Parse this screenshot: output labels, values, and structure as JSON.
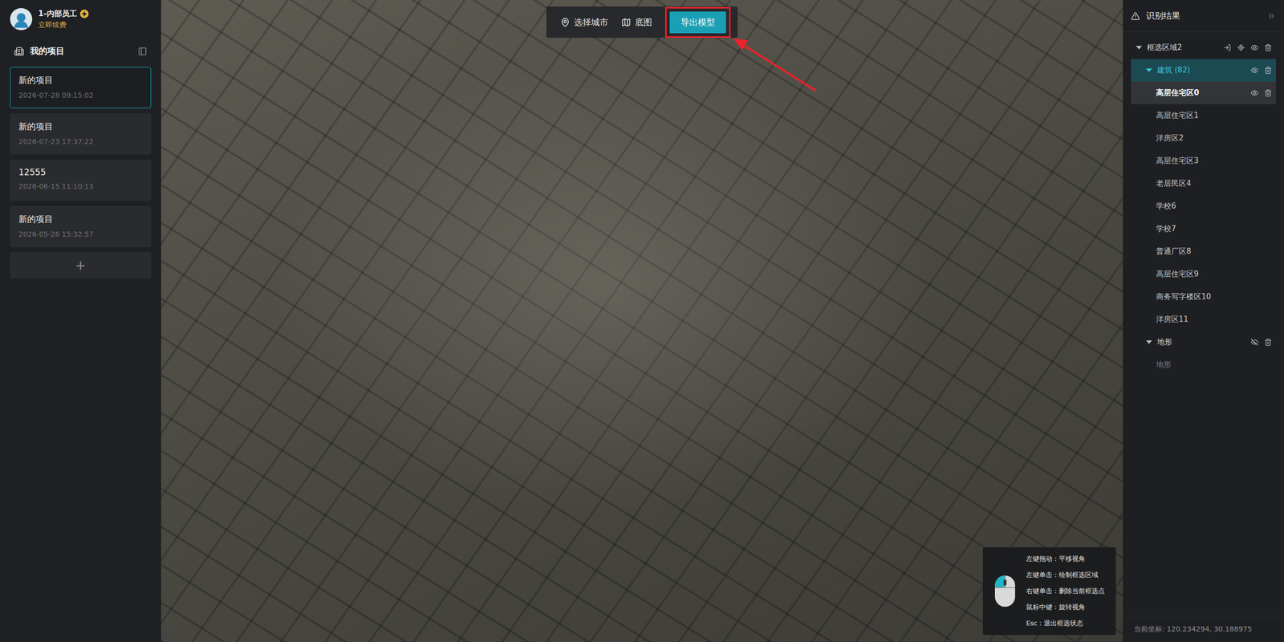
{
  "user": {
    "name": "1-内部员工",
    "renew": "立即续费"
  },
  "projects_header": "我的项目",
  "projects": [
    {
      "name": "新的项目",
      "time": "2026-07-28 09:15:02",
      "selected": true
    },
    {
      "name": "新的项目",
      "time": "2026-07-23 17:37:22",
      "selected": false
    },
    {
      "name": "12555",
      "time": "2026-06-15 11:10:13",
      "selected": false
    },
    {
      "name": "新的项目",
      "time": "2026-05-26 15:32:57",
      "selected": false
    }
  ],
  "add_project": "+",
  "toolbar": [
    {
      "label": "选择城市",
      "kind": "city",
      "annotated": false
    },
    {
      "label": "底图",
      "kind": "basemap",
      "annotated": false
    },
    {
      "label": "导出模型",
      "kind": "primary",
      "annotated": true
    }
  ],
  "panel": {
    "title": "识别结果",
    "region": {
      "label": "框选区域2",
      "expanded": true,
      "groups": [
        {
          "label": "建筑 (82)",
          "expanded": true,
          "selected": true,
          "visible": true,
          "items": [
            {
              "label": "高层住宅区0",
              "selected": true
            },
            {
              "label": "高层住宅区1",
              "selected": false
            },
            {
              "label": "洋房区2",
              "selected": false
            },
            {
              "label": "高层住宅区3",
              "selected": false
            },
            {
              "label": "老居民区4",
              "selected": false
            },
            {
              "label": "学校6",
              "selected": false
            },
            {
              "label": "学校7",
              "selected": false
            },
            {
              "label": "普通厂区8",
              "selected": false
            },
            {
              "label": "高层住宅区9",
              "selected": false
            },
            {
              "label": "商务写字楼区10",
              "selected": false
            },
            {
              "label": "洋房区11",
              "selected": false
            }
          ]
        },
        {
          "label": "地形",
          "expanded": true,
          "selected": false,
          "visible": false,
          "items": [
            {
              "label": "地形",
              "selected": false
            }
          ]
        }
      ]
    }
  },
  "help": [
    "左键拖动：平移视角",
    "左键单击：绘制框选区域",
    "右键单击：删除当前框选点",
    "鼠标中键：旋转视角",
    "Esc：退出框选状态"
  ],
  "status": "当前坐标: 120.234294, 30.188975"
}
